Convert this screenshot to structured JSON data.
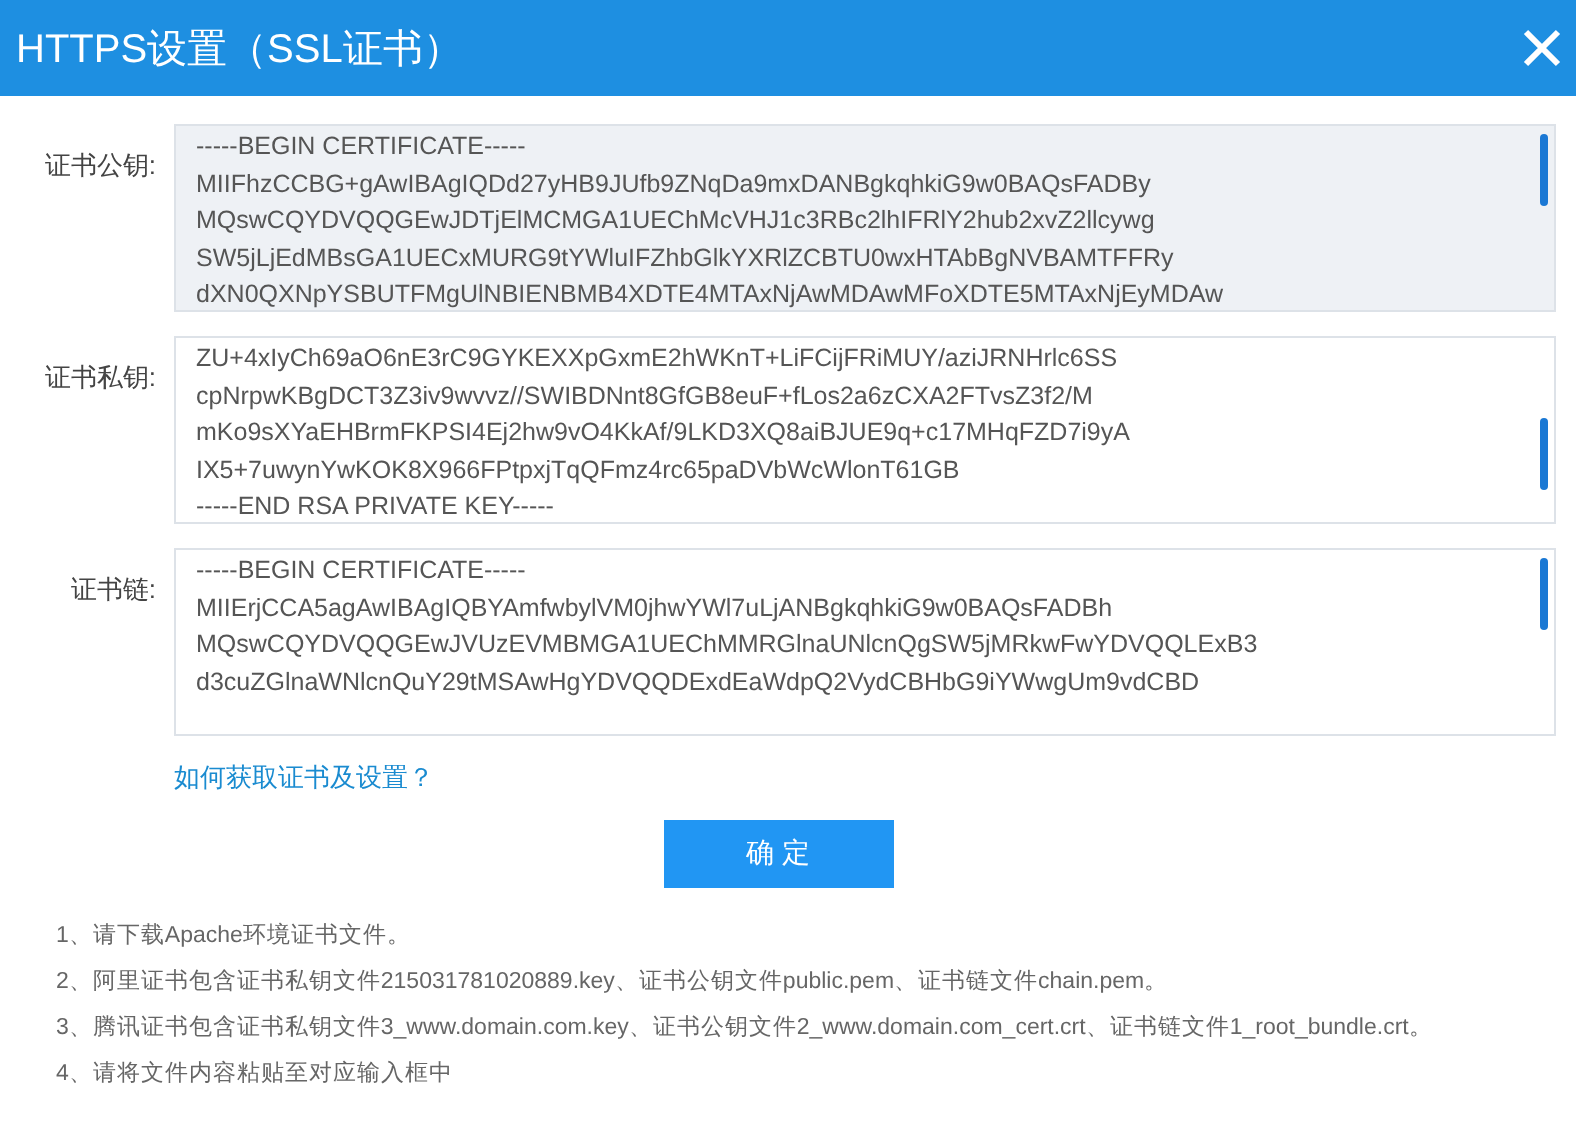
{
  "dialog": {
    "title": "HTTPS设置（SSL证书）"
  },
  "fields": [
    {
      "label": "证书公钥:",
      "disabled": true,
      "lines": [
        "-----BEGIN CERTIFICATE-----",
        "MIIFhzCCBG+gAwIBAgIQDd27yHB9JUfb9ZNqDa9mxDANBgkqhkiG9w0BAQsFADBy",
        "MQswCQYDVQQGEwJDTjElMCMGA1UEChMcVHJ1c3RBc2lhIFRlY2hub2xvZ2llcywg",
        "SW5jLjEdMBsGA1UECxMURG9tYWluIFZhbGlkYXRlZCBTU0wxHTAbBgNVBAMTFFRy",
        "dXN0QXNpYSBUTFMgUlNBIENBMB4XDTE4MTAxNjAwMDAwMFoXDTE5MTAxNjEyMDAw"
      ]
    },
    {
      "label": "证书私钥:",
      "disabled": false,
      "lines": [
        "ZU+4xIyCh69aO6nE3rC9GYKEXXpGxmE2hWKnT+LiFCijFRiMUY/aziJRNHrlc6SS",
        "cpNrpwKBgDCT3Z3iv9wvvz//SWIBDNnt8GfGB8euF+fLos2a6zCXA2FTvsZ3f2/M",
        "mKo9sXYaEHBrmFKPSI4Ej2hw9vO4KkAf/9LKD3XQ8aiBJUE9q+c17MHqFZD7i9yA",
        "IX5+7uwynYwKOK8X966FPtpxjTqQFmz4rc65paDVbWcWlonT61GB",
        "-----END RSA PRIVATE KEY-----"
      ]
    },
    {
      "label": "证书链:",
      "disabled": false,
      "lines": [
        "-----BEGIN CERTIFICATE-----",
        "MIIErjCCA5agAwIBAgIQBYAmfwbylVM0jhwYWl7uLjANBgkqhkiG9w0BAQsFADBh",
        "MQswCQYDVQQGEwJVUzEVMBMGA1UEChMMRGlnaUNlcnQgSW5jMRkwFwYDVQQLExB3",
        "d3cuZGlnaWNlcnQuY29tMSAwHgYDVQQDExdEaWdpQ2VydCBHbG9iYWwgUm9vdCBD"
      ]
    }
  ],
  "help_link": "如何获取证书及设置？",
  "confirm_button": "确 定",
  "notes": [
    "1、请下载Apache环境证书文件。",
    "2、阿里证书包含证书私钥文件215031781020889.key、证书公钥文件public.pem、证书链文件chain.pem。",
    "3、腾讯证书包含证书私钥文件3_www.domain.com.key、证书公钥文件2_www.domain.com_cert.crt、证书链文件1_root_bundle.crt。",
    "4、请将文件内容粘贴至对应输入框中"
  ]
}
